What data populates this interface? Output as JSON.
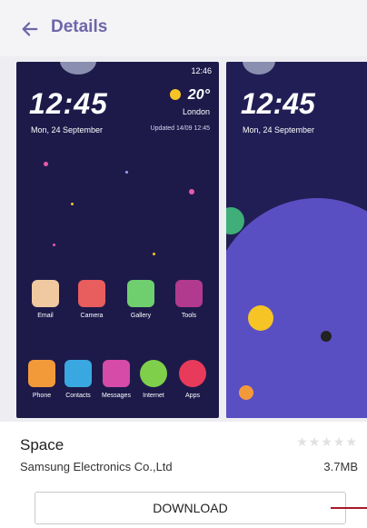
{
  "header": {
    "title": "Details"
  },
  "screenshot1": {
    "status_time": "12:46",
    "clock": "12:45",
    "date": "Mon, 24 September",
    "temperature": "20°",
    "city": "London",
    "updated": "Updated 14/09 12:45",
    "apps": [
      {
        "label": "Email",
        "color": "#f0c9a0"
      },
      {
        "label": "Camera",
        "color": "#e85d5d"
      },
      {
        "label": "Gallery",
        "color": "#6fcf6f"
      },
      {
        "label": "Tools",
        "color": "#b13a8e"
      },
      {
        "label": "Phone",
        "color": "#f29a3a"
      },
      {
        "label": "Contacts",
        "color": "#3aa8e0"
      },
      {
        "label": "Messages",
        "color": "#d64aa8"
      },
      {
        "label": "Internet",
        "color": "#7fcf4a"
      },
      {
        "label": "Apps",
        "color": "#e83a5a"
      }
    ]
  },
  "screenshot2": {
    "clock": "12:45",
    "date": "Mon, 24 September"
  },
  "theme": {
    "name": "Space",
    "publisher": "Samsung Electronics Co.,Ltd",
    "size": "3.7MB",
    "rating_stars": "★★★★★",
    "download_label": "DOWNLOAD"
  },
  "colors": {
    "accent": "#6c66a9",
    "marker": "#a71a28"
  }
}
